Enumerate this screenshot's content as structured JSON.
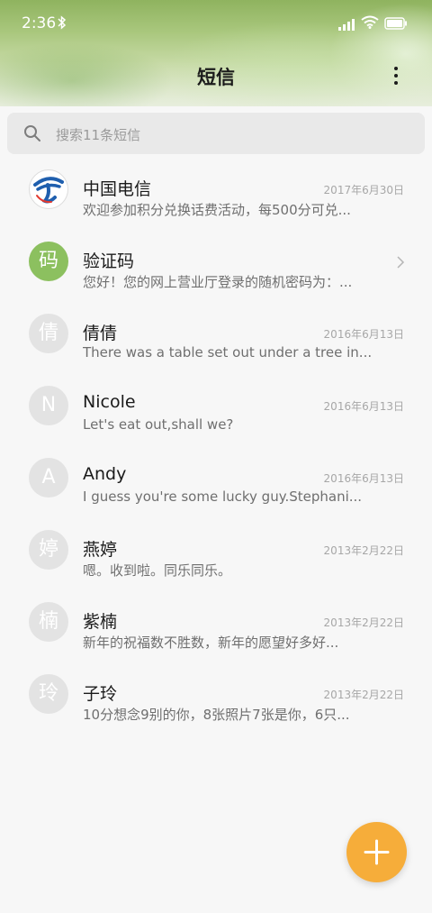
{
  "status_bar": {
    "time": "2:36",
    "icons": [
      "bluetooth-icon",
      "signal-icon",
      "wifi-icon",
      "battery-icon"
    ]
  },
  "header": {
    "title": "短信",
    "more_icon": "more-vertical-icon"
  },
  "search": {
    "placeholder": "搜索11条短信",
    "icon": "search-icon"
  },
  "conversations": [
    {
      "avatar_type": "china-telecom-logo",
      "avatar_text": "",
      "name": "中国电信",
      "date": "2017年6月30日",
      "preview": "欢迎参加积分兑换话费活动，每500分可兑..."
    },
    {
      "avatar_type": "letter",
      "avatar_text": "码",
      "name": "验证码",
      "date": "",
      "preview": "您好！您的网上营业厅登录的随机密码为：...",
      "has_chevron": true,
      "avatar_color": "#8cc05f"
    },
    {
      "avatar_type": "letter",
      "avatar_text": "倩",
      "name": "倩倩",
      "date": "2016年6月13日",
      "preview": "There was a table set out under a tree in..."
    },
    {
      "avatar_type": "letter",
      "avatar_text": "N",
      "name": "Nicole",
      "date": "2016年6月13日",
      "preview": "Let's eat out,shall we?"
    },
    {
      "avatar_type": "letter",
      "avatar_text": "A",
      "name": "Andy",
      "date": "2016年6月13日",
      "preview": "I guess you're some lucky guy.Stephani..."
    },
    {
      "avatar_type": "letter",
      "avatar_text": "婷",
      "name": "燕婷",
      "date": "2013年2月22日",
      "preview": "嗯。收到啦。同乐同乐。"
    },
    {
      "avatar_type": "letter",
      "avatar_text": "楠",
      "name": "紫楠",
      "date": "2013年2月22日",
      "preview": "新年的祝福数不胜数，新年的愿望好多好..."
    },
    {
      "avatar_type": "letter",
      "avatar_text": "玲",
      "name": "子玲",
      "date": "2013年2月22日",
      "preview": "10分想念9别的你，8张照片7张是你，6只..."
    }
  ],
  "fab": {
    "icon": "plus-icon",
    "color": "#f6ad3a"
  }
}
